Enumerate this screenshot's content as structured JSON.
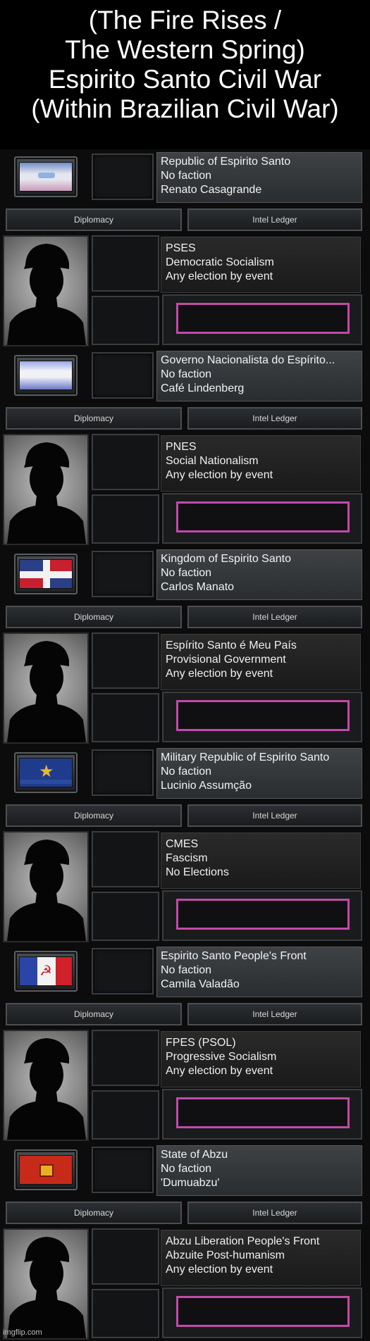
{
  "title": {
    "lines": [
      "(The Fire Rises /",
      "The Western Spring)",
      "Espirito Santo Civil War",
      "(Within Brazilian Civil War)"
    ]
  },
  "tabs": {
    "diplomacy": "Diplomacy",
    "intel": "Intel Ledger"
  },
  "watermark": "imgflip.com",
  "blocks": [
    {
      "flag": "espirito-santo-republic",
      "country": "Republic of Espirito Santo",
      "faction": "No faction",
      "leader": "Renato Casagrande",
      "party": "PSES",
      "ideology": "Democratic Socialism",
      "election": "Any election by event"
    },
    {
      "flag": "nationalist-white-blue",
      "country": "Governo Nacionalista do Espírito...",
      "faction": "No faction",
      "leader": "Café Lindenberg",
      "party": "PNES",
      "ideology": "Social Nationalism",
      "election": "Any election by event"
    },
    {
      "flag": "kingdom-cross",
      "country": "Kingdom of Espirito Santo",
      "faction": "No faction",
      "leader": "Carlos Manato",
      "party": "Espírito Santo é Meu País",
      "ideology": "Provisional Government",
      "election": "Any election by event"
    },
    {
      "flag": "military-star",
      "country": "Military Republic of Espirito Santo",
      "faction": "No faction",
      "leader": "Lucinio Assumção",
      "party": "CMES",
      "ideology": "Fascism",
      "election": "No Elections"
    },
    {
      "flag": "peoples-front-hammer-sickle",
      "country": "Espirito Santo People's Front",
      "faction": "No faction",
      "leader": "Camila Valadão",
      "party": "FPES (PSOL)",
      "ideology": "Progressive Socialism",
      "election": "Any election by event"
    },
    {
      "flag": "abzu-red-emblem",
      "country": "State of Abzu",
      "faction": "No faction",
      "leader": "'Dumuabzu'",
      "party": "Abzu Liberation People's Front",
      "ideology": "Abzuite Post-humanism",
      "election": "Any election by event"
    }
  ],
  "colors": {
    "election_border": "#c24aa8",
    "panel": "#2a2d30"
  }
}
